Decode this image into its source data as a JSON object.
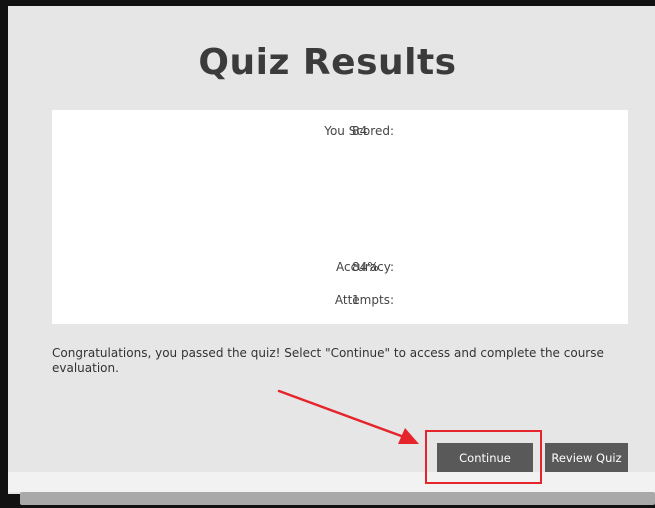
{
  "page": {
    "title": "Quiz Results"
  },
  "results": {
    "score_label": "You Scored:",
    "score_value": "84",
    "accuracy_label": "Accuracy:",
    "accuracy_value": "84%",
    "attempts_label": "Attempts:",
    "attempts_value": "1"
  },
  "message": "Congratulations, you passed the quiz! Select \"Continue\" to access and complete the course evaluation.",
  "buttons": {
    "continue_label": "Continue",
    "review_label": "Review Quiz"
  },
  "annotation": {
    "highlight_color": "#e5252b",
    "arrow_icon": "red-arrow-icon"
  }
}
